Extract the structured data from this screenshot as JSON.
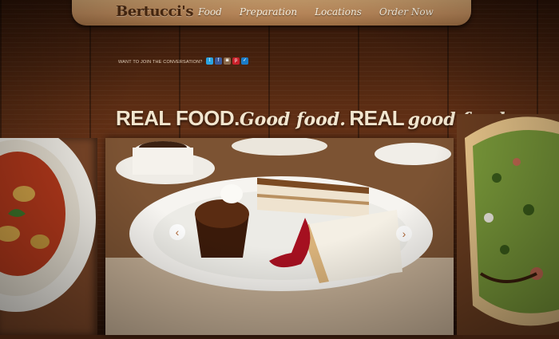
{
  "header": {
    "logo_text": "Bertucci's",
    "nav": [
      {
        "label": "Food"
      },
      {
        "label": "Preparation"
      },
      {
        "label": "Locations"
      },
      {
        "label": "Order Now"
      }
    ]
  },
  "social": {
    "prompt": "WANT TO JOIN THE CONVERSATION?",
    "icons": [
      {
        "name": "twitter-icon",
        "color": "#2aa3e0"
      },
      {
        "name": "facebook-icon",
        "color": "#3b5a9a"
      },
      {
        "name": "instagram-icon",
        "color": "#8a6a4c"
      },
      {
        "name": "pinterest-icon",
        "color": "#c8202a"
      },
      {
        "name": "foursquare-icon",
        "color": "#1a7cc8"
      }
    ]
  },
  "tagline": {
    "part1": "REAL FOOD.",
    "part2": "Good food.",
    "part3": "REAL",
    "part4": "good food."
  },
  "carousel": {
    "prev_glyph": "‹",
    "next_glyph": "›"
  },
  "colors": {
    "accent": "#f2e6cf",
    "wood_dark": "#2b1307",
    "board": "#caa271"
  }
}
